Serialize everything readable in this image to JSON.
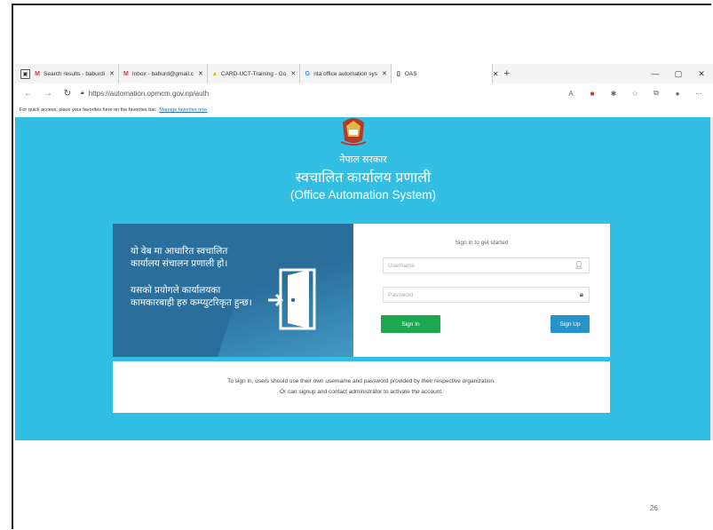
{
  "browser": {
    "tabs": [
      {
        "label": "Search results - baburdi",
        "icon": "outlook-icon",
        "icon_color": "#d63b3b"
      },
      {
        "label": "Inbox - baburd@gmail.c",
        "icon": "gmail-icon",
        "icon_color": "#d63b3b"
      },
      {
        "label": "CARD-UCT-Training - Go",
        "icon": "drive-icon",
        "icon_color": "#f2b705"
      },
      {
        "label": "nta office automation sys",
        "icon": "google-icon",
        "icon_color": "#4285f4"
      },
      {
        "label": "OAS",
        "icon": "page-icon",
        "icon_color": "#444444",
        "active": true
      }
    ],
    "url": "https://automation.opmcm.gov.np/auth",
    "favorites_bar": {
      "text": "For quick access, place your favorites here on the favorites bar.",
      "link": "Manage favorites now"
    }
  },
  "page": {
    "background": "#33bfe3",
    "gov_name_nepali": "नेपाल सरकार",
    "system_name_nepali": "स्वचालित कार्यालय प्रणाली",
    "system_name_english": "(Office Automation System)",
    "intro_line1": "यो वेब मा आधारित स्वचालित कार्यालय संचालन प्रणाली हो।",
    "intro_line2": "यसको प्रयोगले कार्यालयका कामकारबाही हरु कम्प्युटरिकृत हुन्छ।",
    "login": {
      "title": "Sign in to get started",
      "username_placeholder": "Username",
      "password_placeholder": "Password",
      "signin_label": "Sign In",
      "signup_label": "Sign Up",
      "signin_color": "#1aa851",
      "signup_color": "#2794c9"
    },
    "info_line1": "To sign in, users should use their own username and password provided by their respective organization.",
    "info_line2": "Or can signup and contact administrator to activate the account."
  },
  "slide": {
    "page_number": "26"
  }
}
